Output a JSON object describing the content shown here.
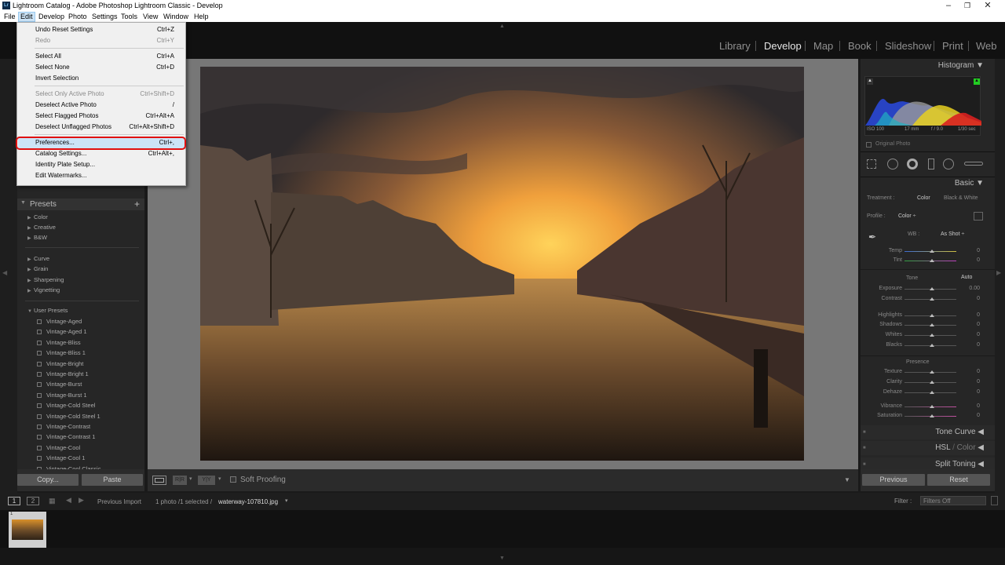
{
  "window": {
    "title": "Lightroom Catalog - Adobe Photoshop Lightroom Classic - Develop",
    "icon_label": "Lr"
  },
  "menubar": [
    "File",
    "Edit",
    "Develop",
    "Photo",
    "Settings",
    "Tools",
    "View",
    "Window",
    "Help"
  ],
  "modules": [
    "Library",
    "Develop",
    "Map",
    "Book",
    "Slideshow",
    "Print",
    "Web"
  ],
  "edit_menu": [
    {
      "label": "Undo Reset Settings",
      "shortcut": "Ctrl+Z",
      "disabled": false
    },
    {
      "label": "Redo",
      "shortcut": "Ctrl+Y",
      "disabled": true
    },
    {
      "label": "Select All",
      "shortcut": "Ctrl+A",
      "disabled": false
    },
    {
      "label": "Select None",
      "shortcut": "Ctrl+D",
      "disabled": false
    },
    {
      "label": "Invert Selection",
      "shortcut": "",
      "disabled": false
    },
    {
      "label": "Select Only Active Photo",
      "shortcut": "Ctrl+Shift+D",
      "disabled": true
    },
    {
      "label": "Deselect Active Photo",
      "shortcut": "/",
      "disabled": false
    },
    {
      "label": "Select Flagged Photos",
      "shortcut": "Ctrl+Alt+A",
      "disabled": false
    },
    {
      "label": "Deselect Unflagged Photos",
      "shortcut": "Ctrl+Alt+Shift+D",
      "disabled": false
    },
    {
      "label": "Preferences...",
      "shortcut": "Ctrl+,",
      "disabled": false
    },
    {
      "label": "Catalog Settings...",
      "shortcut": "Ctrl+Alt+,",
      "disabled": false
    },
    {
      "label": "Identity Plate Setup...",
      "shortcut": "",
      "disabled": false
    },
    {
      "label": "Edit Watermarks...",
      "shortcut": "",
      "disabled": false
    }
  ],
  "left_panel": {
    "presets_title": "Presets",
    "add": "+",
    "groups1": [
      "Color",
      "Creative",
      "B&W"
    ],
    "groups2": [
      "Curve",
      "Grain",
      "Sharpening",
      "Vignetting"
    ],
    "user_presets_title": "User Presets",
    "user_presets": [
      "Vintage-Aged",
      "Vintage-Aged 1",
      "Vintage-Bliss",
      "Vintage-Bliss 1",
      "Vintage-Bright",
      "Vintage-Bright 1",
      "Vintage-Burst",
      "Vintage-Burst 1",
      "Vintage-Cold Steel",
      "Vintage-Cold Steel 1",
      "Vintage-Contrast",
      "Vintage-Contrast 1",
      "Vintage-Cool",
      "Vintage-Cool 1",
      "Vintage-Cool Classic"
    ],
    "copy": "Copy...",
    "paste": "Paste"
  },
  "toolbar": {
    "soft_proofing": "Soft Proofing",
    "yy": "Y|Y"
  },
  "right_panel": {
    "histogram": "Histogram",
    "exif": [
      "ISO 100",
      "17 mm",
      "f / 9.0",
      "1/30 sec"
    ],
    "original_photo": "Original Photo",
    "basic": "Basic",
    "treatment_label": "Treatment :",
    "treatment_color": "Color",
    "treatment_bw": "Black & White",
    "profile_label": "Profile :",
    "profile_value": "Color ÷",
    "wb_label": "WB :",
    "wb_value": "As Shot ÷",
    "tone_label": "Tone",
    "auto": "Auto",
    "presence_label": "Presence",
    "sliders": [
      {
        "label": "Temp",
        "value": "0"
      },
      {
        "label": "Tint",
        "value": "0"
      },
      {
        "label": "Exposure",
        "value": "0.00"
      },
      {
        "label": "Contrast",
        "value": "0"
      },
      {
        "label": "Highlights",
        "value": "0"
      },
      {
        "label": "Shadows",
        "value": "0"
      },
      {
        "label": "Whites",
        "value": "0"
      },
      {
        "label": "Blacks",
        "value": "0"
      },
      {
        "label": "Texture",
        "value": "0"
      },
      {
        "label": "Clarity",
        "value": "0"
      },
      {
        "label": "Dehaze",
        "value": "0"
      },
      {
        "label": "Vibrance",
        "value": "0"
      },
      {
        "label": "Saturation",
        "value": "0"
      }
    ],
    "tone_curve": "Tone Curve",
    "hsl": "HSL",
    "hsl_sep": "/",
    "hsl_color": "Color",
    "split_toning": "Split Toning",
    "previous": "Previous",
    "reset": "Reset"
  },
  "filmstrip": {
    "page1": "1",
    "page2": "2",
    "source": "Previous Import",
    "info": "1 photo /1 selected /",
    "filename": "waterway-107810.jpg",
    "filter_label": "Filter :",
    "filter_value": "Filters Off",
    "thumb_index": "1"
  },
  "colors": {
    "accent_red": "#e01010",
    "menu_highlight": "#cce4f7"
  }
}
